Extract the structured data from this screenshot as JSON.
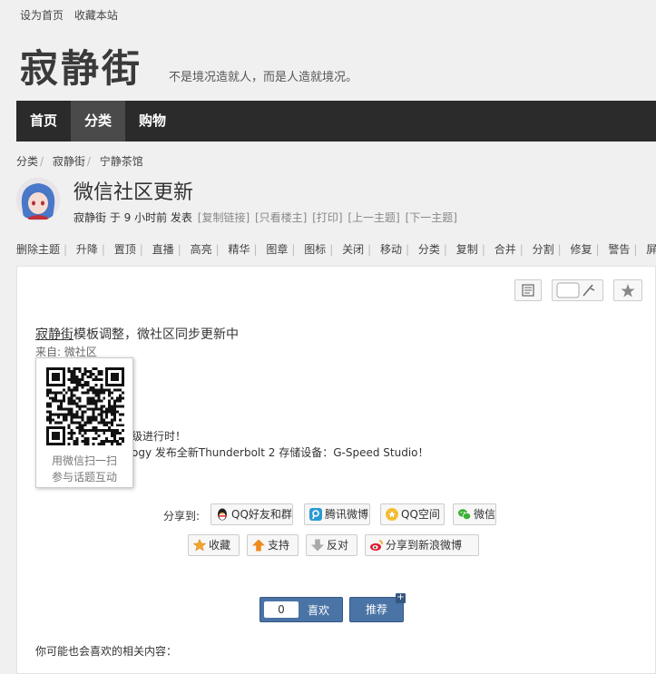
{
  "top_links": [
    "设为首页",
    "收藏本站"
  ],
  "site": {
    "logo": "寂静街",
    "slogan": "不是境况造就人，而是人造就境况。"
  },
  "nav": {
    "items": [
      "首页",
      "分类",
      "购物"
    ],
    "active_index": 1
  },
  "breadcrumb": [
    "分类",
    "寂静街",
    "宁静茶馆"
  ],
  "post": {
    "title": "微信社区更新",
    "author": "寂静街",
    "time_text": "于 9 小时前 发表",
    "links": [
      "[复制链接]",
      "[只看楼主]",
      "[打印]",
      "[上一主题]",
      "[下一主题]"
    ]
  },
  "mod_actions": [
    "删除主题",
    "升降",
    "置顶",
    "直播",
    "高亮",
    "精华",
    "图章",
    "图标",
    "关闭",
    "移动",
    "分类",
    "复制",
    "合并",
    "分割",
    "修复",
    "警告",
    "屏蔽"
  ],
  "content": {
    "head_link": "寂静街",
    "head_rest": "模板调整，微社区同步更新中",
    "source": "来自: 微社区",
    "line1": "级进行时！",
    "line2": "ogy 发布全新Thunderbolt 2 存储设备：G-Speed Studio！"
  },
  "qr_popup": {
    "line1": "用微信扫一扫",
    "line2": "参与话题互动"
  },
  "share": {
    "label": "分享到:",
    "buttons": [
      "QQ好友和群",
      "腾讯微博",
      "QQ空间",
      "微信"
    ]
  },
  "actions": [
    "收藏",
    "支持",
    "反对",
    "分享到新浪微博"
  ],
  "like": {
    "count": "0",
    "label": "喜欢",
    "recommend": "推荐",
    "plus": "+"
  },
  "related_label": "你可能也会喜欢的相关内容："
}
